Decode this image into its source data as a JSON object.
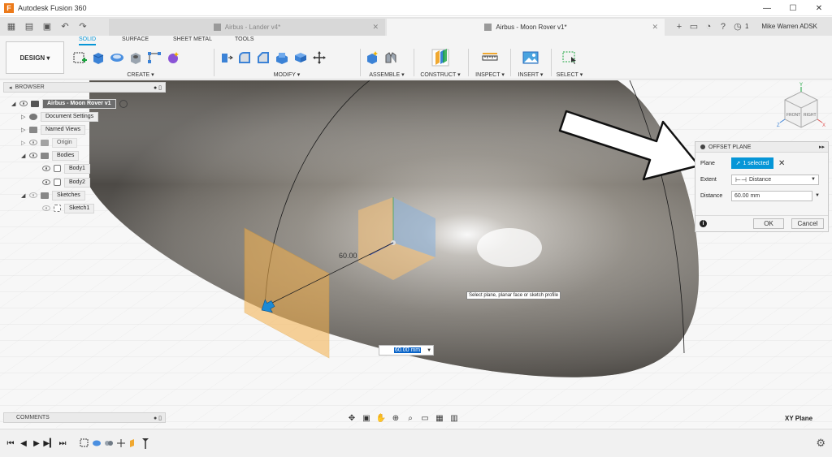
{
  "app": {
    "title": "Autodesk Fusion 360",
    "logo_letter": "F"
  },
  "window_controls": {
    "minimize": "—",
    "maximize": "☐",
    "close": "✕"
  },
  "tabs": [
    {
      "label": "Airbus - Lander v4*",
      "active": false
    },
    {
      "label": "Airbus - Moon Rover v1*",
      "active": true
    }
  ],
  "header": {
    "job_count": "1",
    "user": "Mike Warren ADSK"
  },
  "ribbon": {
    "workspace": "DESIGN",
    "workspace_tabs": [
      "SOLID",
      "SURFACE",
      "SHEET METAL",
      "TOOLS"
    ],
    "groups": {
      "create": "CREATE",
      "modify": "MODIFY",
      "assemble": "ASSEMBLE",
      "construct": "CONSTRUCT",
      "inspect": "INSPECT",
      "insert": "INSERT",
      "select": "SELECT"
    }
  },
  "browser": {
    "title": "BROWSER",
    "root": "Airbus - Moon Rover v1",
    "items": {
      "document_settings": "Document Settings",
      "named_views": "Named Views",
      "origin": "Origin",
      "bodies": "Bodies",
      "body1": "Body1",
      "body2": "Body2",
      "sketches": "Sketches",
      "sketch1": "Sketch1"
    }
  },
  "dialog": {
    "title": "OFFSET PLANE",
    "plane_label": "Plane",
    "plane_value": "1 selected",
    "extent_label": "Extent",
    "extent_value": "Distance",
    "distance_label": "Distance",
    "distance_value": "60.00 mm",
    "ok": "OK",
    "cancel": "Cancel"
  },
  "viewport": {
    "tooltip": "Select plane, planar face or sketch profile",
    "dimension_label": "60.00",
    "dimension_input": "60.00 mm",
    "view_plane": "XY Plane",
    "viewcube_front": "FRONT",
    "viewcube_right": "RIGHT",
    "axis_z": "Z",
    "axis_y": "Y",
    "axis_x": "X"
  },
  "comments": {
    "title": "COMMENTS"
  },
  "colors": {
    "accent": "#0696d7",
    "plane_fill": "#f5b04a"
  }
}
